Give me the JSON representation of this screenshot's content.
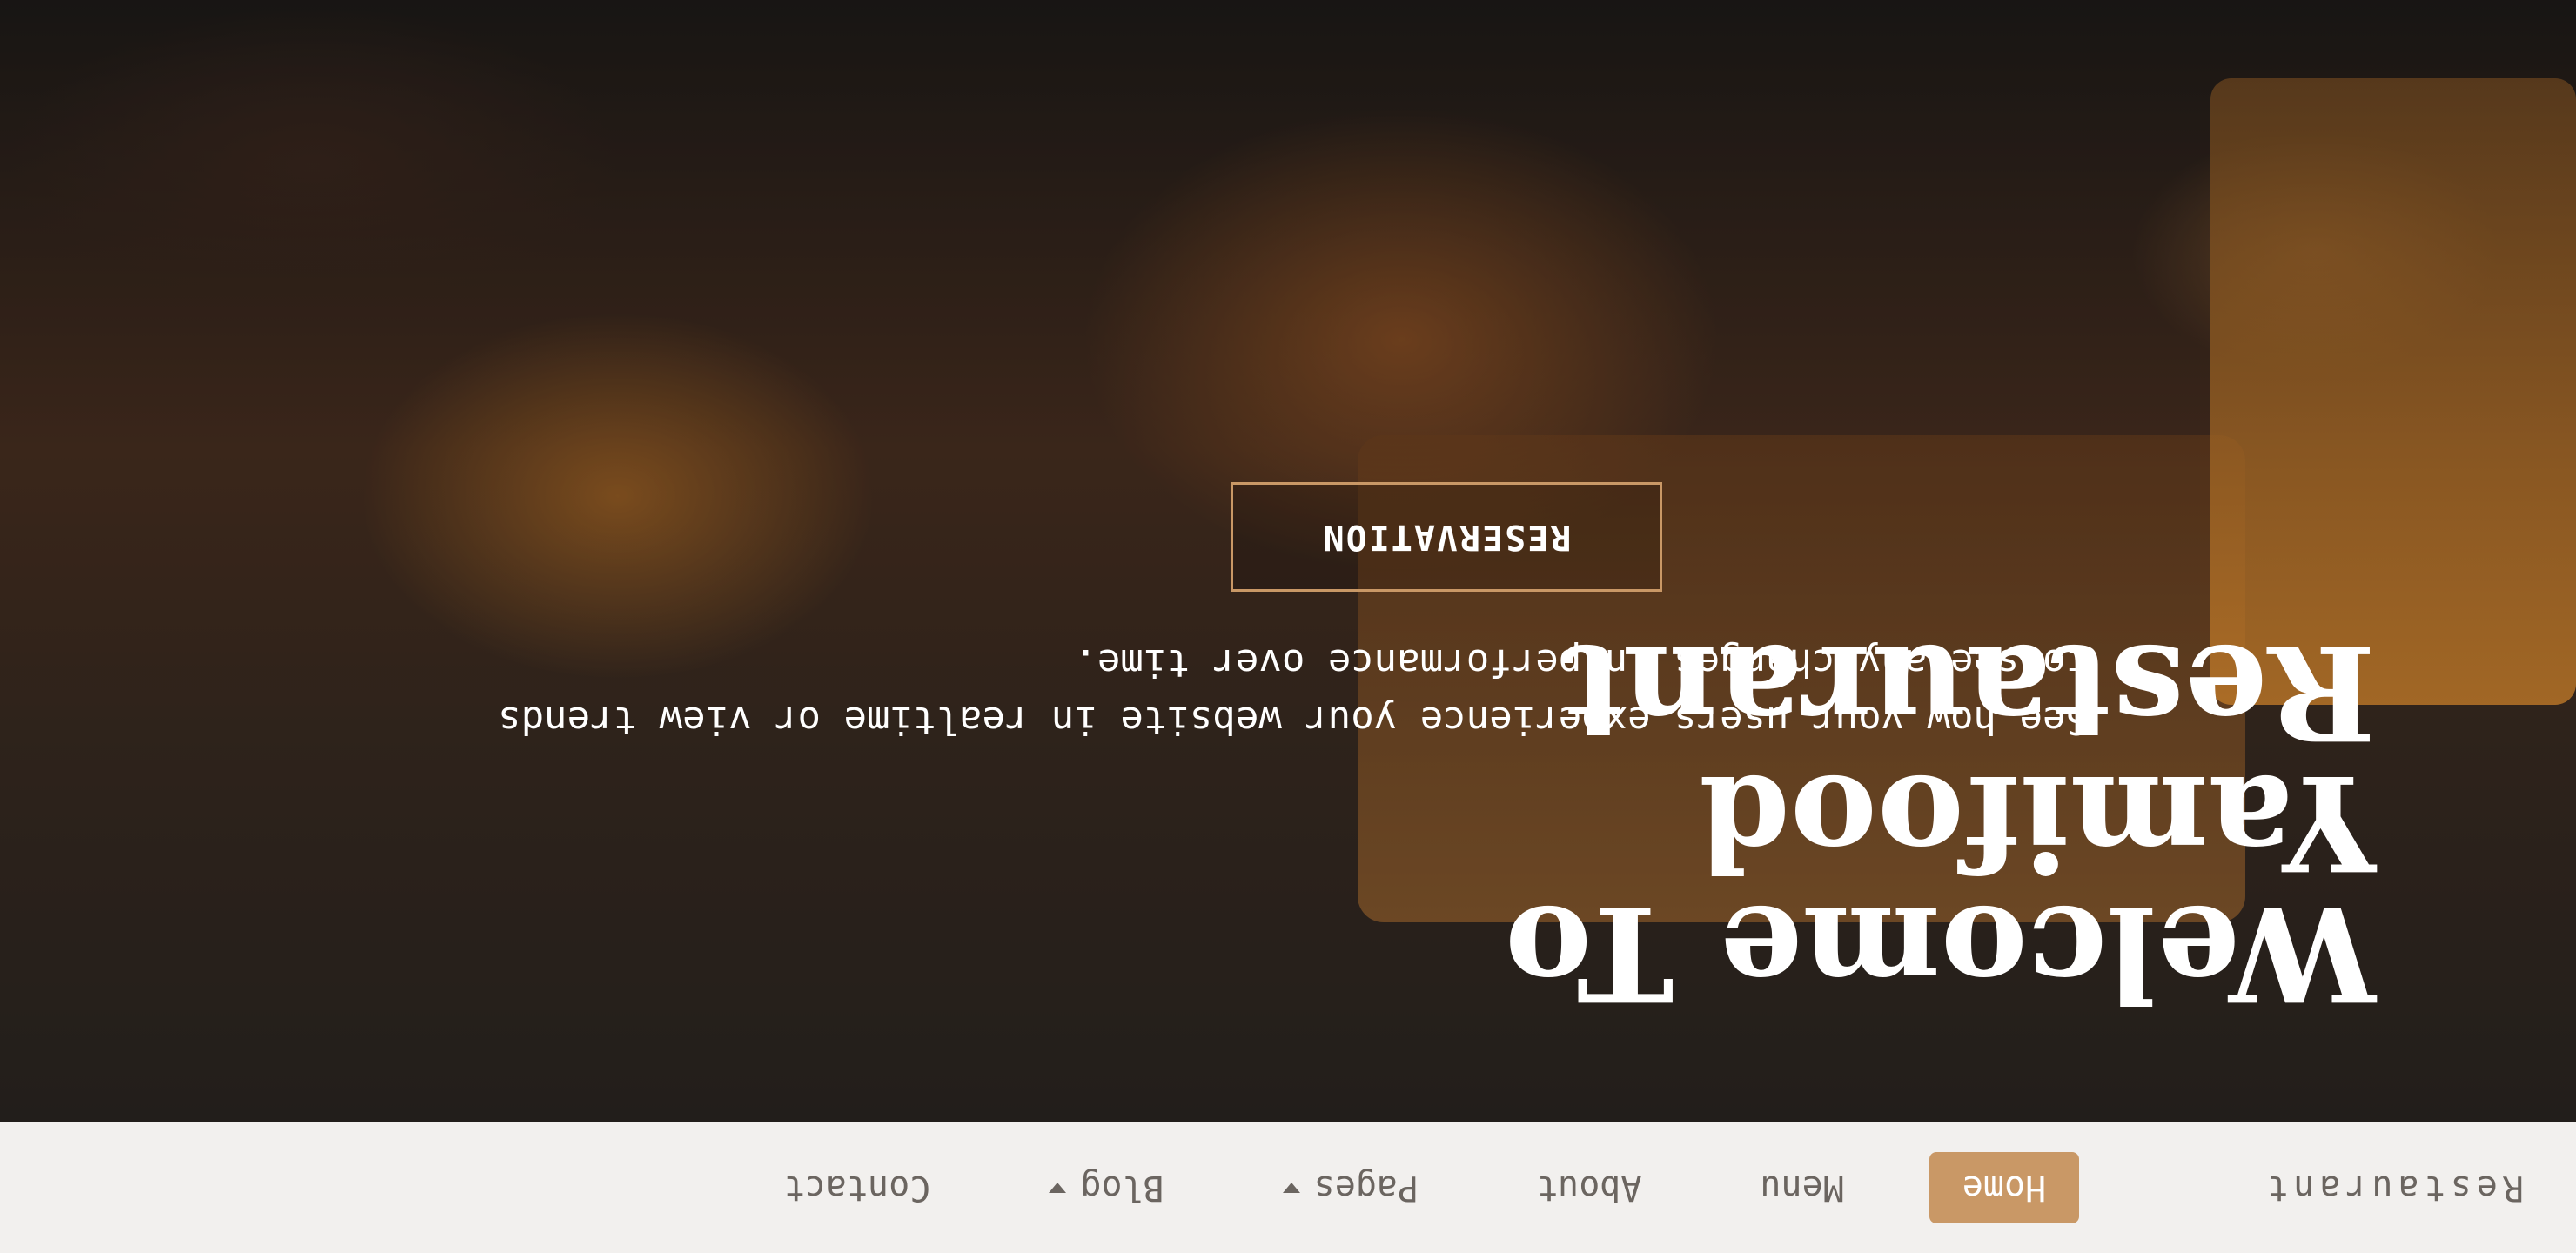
{
  "brand": "Restaurant",
  "nav": {
    "items": [
      {
        "label": "Home",
        "active": true
      },
      {
        "label": "Menu"
      },
      {
        "label": "About"
      },
      {
        "label": "Pages"
      },
      {
        "label": "Blog"
      },
      {
        "label": "Contact"
      }
    ]
  },
  "hero": {
    "title_line1": "Welcome To",
    "title_line2": "Yamifood Restaurant",
    "subtitle": "See how your users experience your website in realtime or view trends to see any changes in performance over time.",
    "button_label": "RESERVATION"
  },
  "slider": {
    "slide_count": 3,
    "active_index": 0
  },
  "colors": {
    "accent": "#c99866",
    "nav_bg": "#f2f0ee",
    "nav_text": "#6b6560"
  }
}
